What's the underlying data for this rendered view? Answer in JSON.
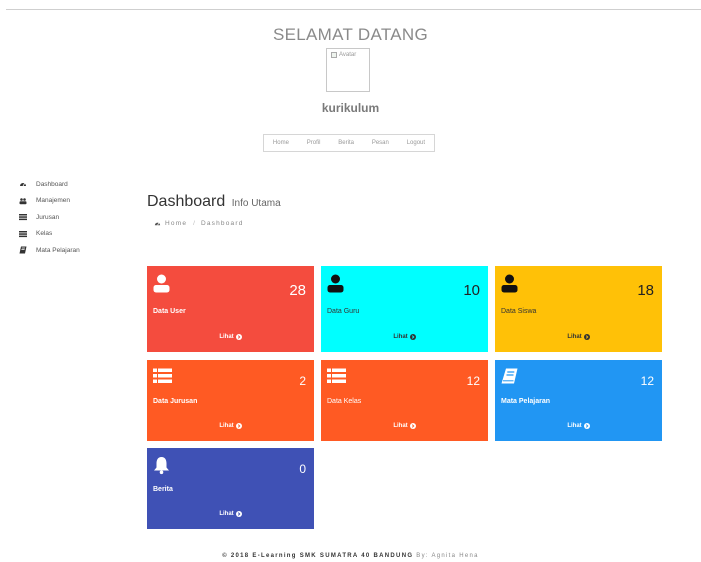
{
  "header": {
    "welcome": "SELAMAT DATANG",
    "avatar_alt": "Avatar",
    "username": "kurikulum"
  },
  "topnav": [
    {
      "label": "Home"
    },
    {
      "label": "Profil"
    },
    {
      "label": "Berita"
    },
    {
      "label": "Pesan"
    },
    {
      "label": "Logout"
    }
  ],
  "sidebar": {
    "items": [
      {
        "label": "Dashboard",
        "icon": "dashboard-icon"
      },
      {
        "label": "Manajemen",
        "icon": "users-icon"
      },
      {
        "label": "Jurusan",
        "icon": "list-icon"
      },
      {
        "label": "Kelas",
        "icon": "list-icon"
      },
      {
        "label": "Mata Pelajaran",
        "icon": "book-icon"
      }
    ]
  },
  "page": {
    "title": "Dashboard",
    "subtitle": "Info Utama"
  },
  "breadcrumb": {
    "home": "Home",
    "sep": "/",
    "current": "Dashboard"
  },
  "cards": [
    {
      "label": "Data User",
      "count": "28",
      "link": "Lihat",
      "icon": "user-icon",
      "color": "#f44c3e"
    },
    {
      "label": "Data Guru",
      "count": "10",
      "link": "Lihat",
      "icon": "user-icon",
      "color": "#00ffff"
    },
    {
      "label": "Data Siswa",
      "count": "18",
      "link": "Lihat",
      "icon": "user-icon",
      "color": "#ffc107"
    },
    {
      "label": "Data Jurusan",
      "count": "2",
      "link": "Lihat",
      "icon": "list-icon",
      "color": "#ff5a23"
    },
    {
      "label": "Data Kelas",
      "count": "12",
      "link": "Lihat",
      "icon": "list-icon",
      "color": "#ff5a23"
    },
    {
      "label": "Mata Pelajaran",
      "count": "12",
      "link": "Lihat",
      "icon": "book-icon",
      "color": "#2196f3"
    },
    {
      "label": "Berita",
      "count": "0",
      "link": "Lihat",
      "icon": "bell-icon",
      "color": "#3f51b5"
    }
  ],
  "footer": {
    "copyright": "© 2018 E-Learning SMK SUMATRA 40 BANDUNG",
    "by": "By: Agnita Hena"
  }
}
